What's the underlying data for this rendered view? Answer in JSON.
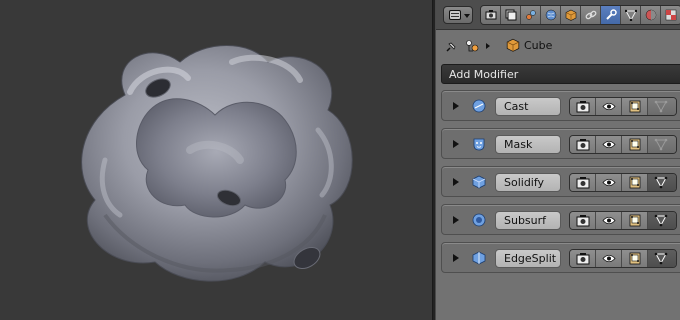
{
  "viewport": {
    "object": "smooth-organic-mesh",
    "background": "#393939",
    "mesh_color": "#8d8f9b"
  },
  "properties": {
    "header": {
      "editor_icon": "properties-editor-icon",
      "context_tabs": [
        "render",
        "render-layers",
        "scene",
        "world",
        "object",
        "constraints",
        "modifiers",
        "data",
        "material",
        "texture"
      ],
      "active_tab": "modifiers"
    },
    "breadcrumb": {
      "object_name": "Cube"
    },
    "add_modifier_label": "Add Modifier",
    "modifiers": [
      {
        "name": "Cast",
        "icon": "cast-icon",
        "edit_mode_enabled": false
      },
      {
        "name": "Mask",
        "icon": "mask-icon",
        "edit_mode_enabled": false
      },
      {
        "name": "Solidify",
        "icon": "solidify-icon",
        "edit_mode_enabled": true
      },
      {
        "name": "Subsurf",
        "icon": "subsurf-icon",
        "edit_mode_enabled": true
      },
      {
        "name": "EdgeSplit",
        "icon": "edgesplit-icon",
        "edit_mode_enabled": true
      }
    ],
    "accent_color": "#5b7fc0"
  }
}
